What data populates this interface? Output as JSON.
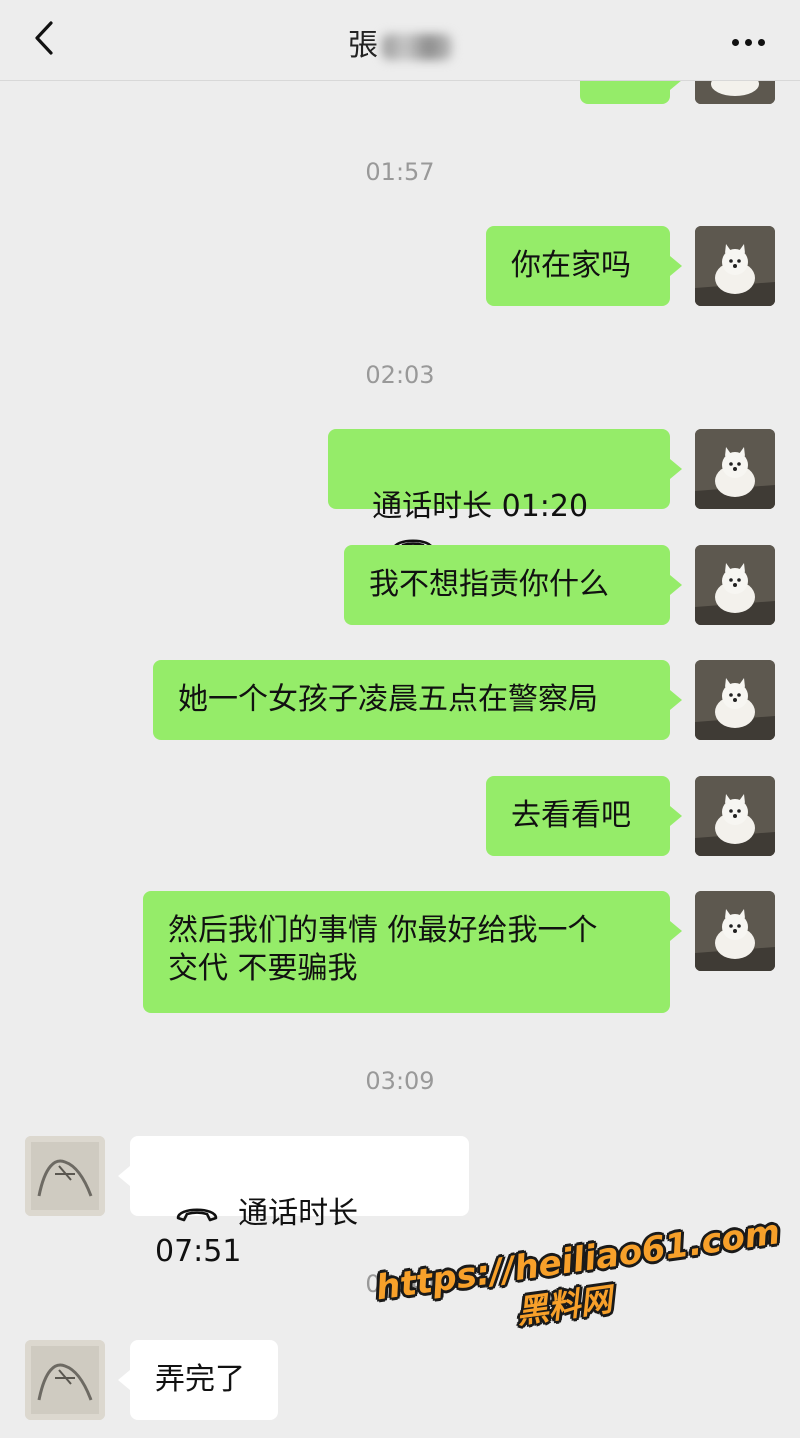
{
  "header": {
    "title_visible": "張",
    "back_icon": "chevron-left-icon",
    "more_icon": "more-dots-icon"
  },
  "messages": {
    "ts1": "01:57",
    "m1": "你在家吗",
    "ts2": "02:03",
    "call1_label": "通话时长 01:20",
    "m2": "我不想指责你什么",
    "m3": "她一个女孩子凌晨五点在警察局",
    "m4": "去看看吧",
    "m5": "然后我们的事情 你最好给我一个\n交代 不要骗我",
    "ts3": "03:09",
    "call2_label": "通话时长 07:51",
    "ts4": "04:40",
    "m6": "弄完了"
  },
  "watermark": {
    "url": "https://heiliao61.com",
    "site": "黑料网"
  },
  "colors": {
    "background": "#ededed",
    "my_bubble": "#95ec69",
    "their_bubble": "#ffffff",
    "timestamp": "#999999",
    "watermark": "#f7a02a"
  }
}
